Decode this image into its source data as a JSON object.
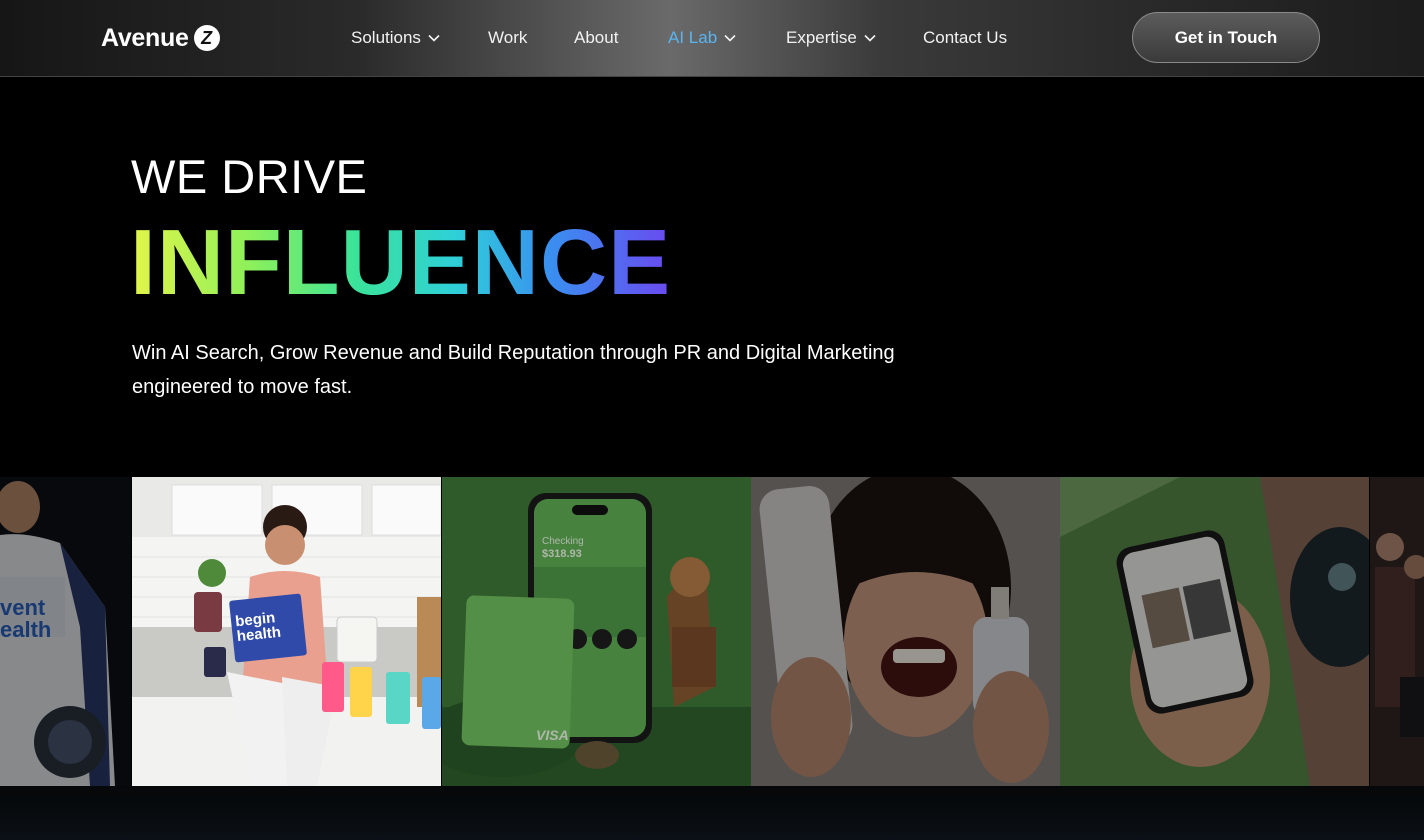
{
  "brand": {
    "name": "Avenue",
    "mark": "Z"
  },
  "nav": {
    "items": [
      {
        "label": "Solutions",
        "has_dropdown": true
      },
      {
        "label": "Work",
        "has_dropdown": false
      },
      {
        "label": "About",
        "has_dropdown": false
      },
      {
        "label": "AI Lab",
        "has_dropdown": true,
        "active": true
      },
      {
        "label": "Expertise",
        "has_dropdown": true
      },
      {
        "label": "Contact Us",
        "has_dropdown": false
      }
    ],
    "cta_label": "Get in Touch"
  },
  "hero": {
    "kicker": "WE DRIVE",
    "title": "INFLUENCE",
    "subtitle_line1": "Win AI Search, Grow Revenue and Build Reputation through PR and Digital Marketing",
    "subtitle_line2": "engineered to move fast."
  },
  "gallery": {
    "tiles": [
      {
        "name": "racing-driver-photo",
        "text_1": "vent",
        "text_2": "ealth"
      },
      {
        "name": "child-kitchen-photo",
        "product_1": "begin",
        "product_2": "health"
      },
      {
        "name": "banking-app-photo",
        "account_label": "Checking",
        "account_value": "$318.93",
        "card_brand": "VISA"
      },
      {
        "name": "smiling-woman-skincare-photo"
      },
      {
        "name": "phone-app-outdoor-photo"
      },
      {
        "name": "crowd-photo"
      }
    ]
  },
  "colors": {
    "accent_active": "#5ab4f0",
    "gradient": [
      "#e4f54a",
      "#8ef05a",
      "#3ae39a",
      "#2fd0d8",
      "#3a8ef0",
      "#6a4af0"
    ]
  }
}
